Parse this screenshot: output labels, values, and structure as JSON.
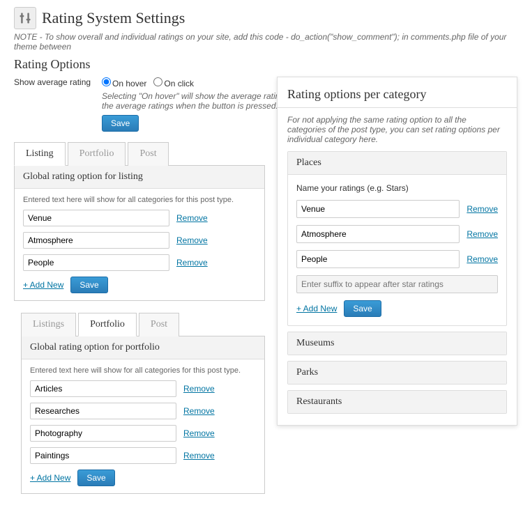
{
  "header": {
    "title": "Rating System Settings"
  },
  "note": "NOTE - To show overall and individual ratings on your site, add this code - do_action(\"show_comment\"); in comments.php file of your theme between",
  "subheader": "Rating Options",
  "avg": {
    "label": "Show average rating",
    "opt1": "On hover",
    "opt2": "On click",
    "help": "Selecting \"On hover\" will show the average ratings when mouse is hovered on the button. \"On click\" will show the average ratings when the button is pressed.",
    "save": "Save"
  },
  "tabs1": {
    "listing": "Listing",
    "portfolio": "Portfolio",
    "post": "Post"
  },
  "panel1": {
    "title": "Global rating option for listing",
    "hint": "Entered text here will show for all categories for this post type.",
    "r1": "Venue",
    "r2": "Atmosphere",
    "r3": "People",
    "remove": "Remove",
    "add": "+ Add New",
    "save": "Save"
  },
  "tabs2": {
    "listings": "Listings",
    "portfolio": "Portfolio",
    "post": "Post"
  },
  "panel2": {
    "title": "Global rating option for portfolio",
    "hint": "Entered text here will show for all categories for this post type.",
    "r1": "Articles",
    "r2": "Researches",
    "r3": "Photography",
    "r4": "Paintings",
    "remove": "Remove",
    "add": "+ Add New",
    "save": "Save"
  },
  "right": {
    "title": "Rating options per category",
    "desc": "For not applying the same rating option to all the categories of the post type, you can set rating options per individual category here.",
    "places": {
      "head": "Places",
      "label": "Name your ratings (e.g. Stars)",
      "r1": "Venue",
      "r2": "Atmosphere",
      "r3": "People",
      "remove": "Remove",
      "suffix_ph": "Enter suffix to appear after star ratings",
      "add": "+ Add New",
      "save": "Save"
    },
    "museums": "Museums",
    "parks": "Parks",
    "restaurants": "Restaurants"
  }
}
